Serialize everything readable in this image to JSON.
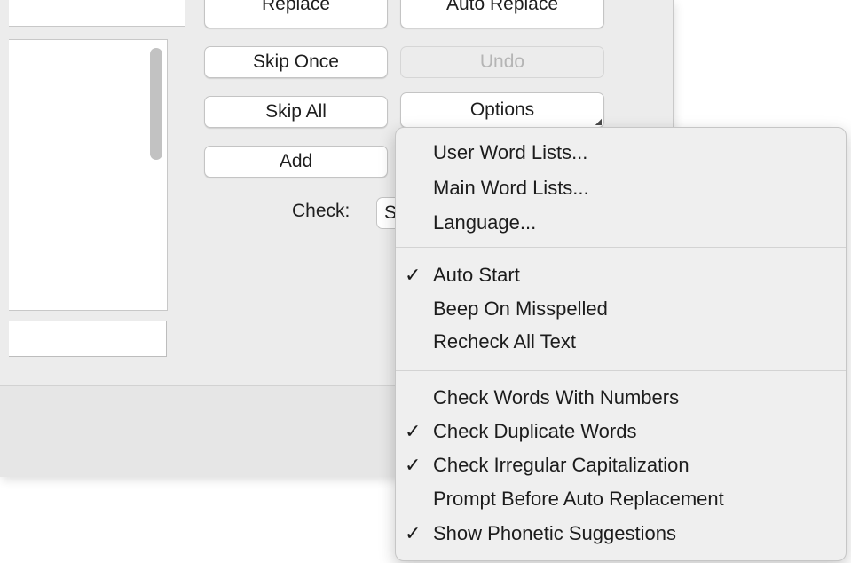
{
  "dialog": {
    "buttons": {
      "replace": "Replace",
      "auto_replace": "Auto Replace",
      "skip_once": "Skip Once",
      "undo": "Undo",
      "skip_all": "Skip All",
      "options": "Options",
      "add": "Add"
    },
    "check_label": "Check:",
    "check_value": "S"
  },
  "options_menu": {
    "groups": [
      [
        {
          "label": "User Word Lists...",
          "checked": false
        },
        {
          "label": "Main Word Lists...",
          "checked": false
        },
        {
          "label": "Language...",
          "checked": false
        }
      ],
      [
        {
          "label": "Auto Start",
          "checked": true
        },
        {
          "label": "Beep On Misspelled",
          "checked": false
        },
        {
          "label": "Recheck All Text",
          "checked": false
        }
      ],
      [
        {
          "label": "Check Words With Numbers",
          "checked": false
        },
        {
          "label": "Check Duplicate Words",
          "checked": true
        },
        {
          "label": "Check Irregular Capitalization",
          "checked": true
        },
        {
          "label": "Prompt Before Auto Replacement",
          "checked": false
        },
        {
          "label": "Show Phonetic Suggestions",
          "checked": true
        }
      ]
    ],
    "checkmark_glyph": "✓"
  }
}
